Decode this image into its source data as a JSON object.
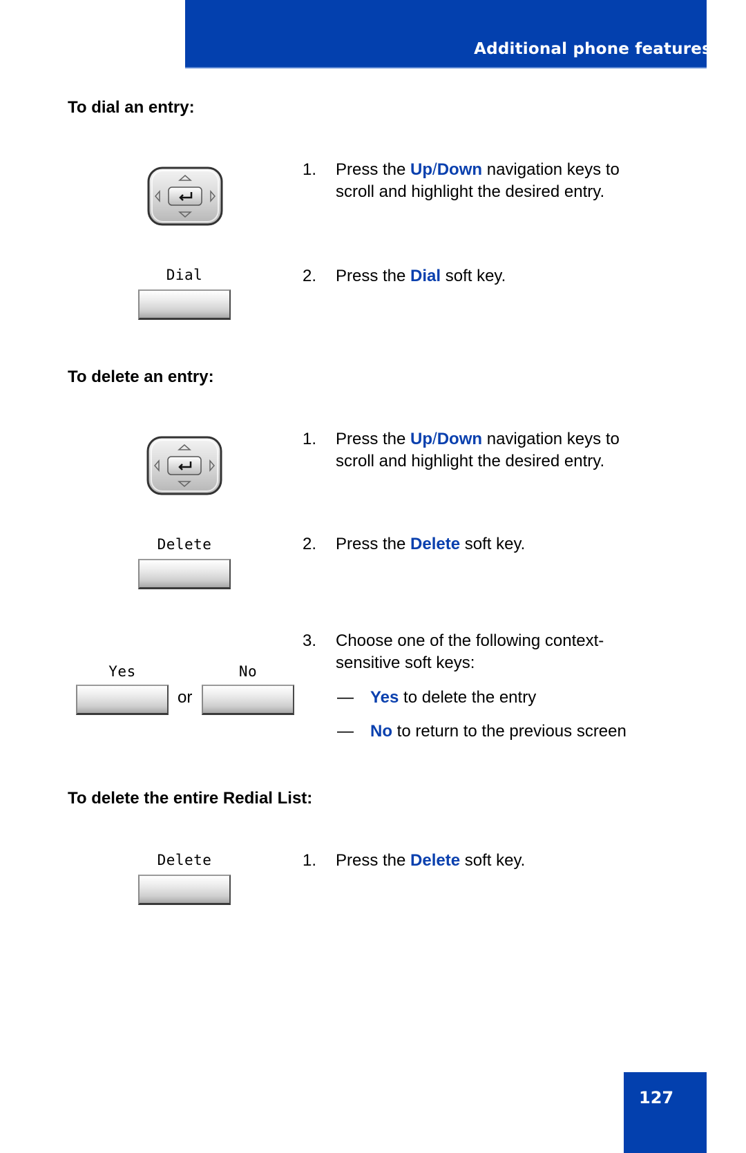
{
  "header": {
    "title": "Additional phone features"
  },
  "colors": {
    "brand_blue": "#0340ae",
    "highlight_blue": "#0a40ae"
  },
  "sections": [
    {
      "heading": "To dial an entry:",
      "steps": [
        {
          "num": "1.",
          "pre": "Press the ",
          "hl1": "Up",
          "sep": "/",
          "hl2": "Down",
          "post": " navigation keys to",
          "line2": "scroll and highlight the desired entry.",
          "icon": "navigation-pad-icon"
        },
        {
          "num": "2.",
          "pre": "Press the ",
          "hl": "Dial",
          "post": " soft key.",
          "softkey_label": "Dial"
        }
      ]
    },
    {
      "heading": "To delete an entry:",
      "steps": [
        {
          "num": "1.",
          "pre": "Press the ",
          "hl1": "Up",
          "sep": "/",
          "hl2": "Down",
          "post": " navigation keys to",
          "line2": "scroll and highlight the desired entry.",
          "icon": "navigation-pad-icon"
        },
        {
          "num": "2.",
          "pre": "Press the ",
          "hl": "Delete",
          "post": " soft key.",
          "softkey_label": "Delete"
        },
        {
          "num": "3.",
          "line1": "Choose one of the following context-",
          "line2": "sensitive soft keys:",
          "softkeys": [
            "Yes",
            "No"
          ],
          "or_label": "or",
          "options": [
            {
              "dash": "—",
              "hl": "Yes",
              "text": " to delete the entry"
            },
            {
              "dash": "—",
              "hl": "No",
              "text": " to return to the previous screen"
            }
          ]
        }
      ]
    },
    {
      "heading": "To delete the entire Redial List:",
      "steps": [
        {
          "num": "1.",
          "pre": "Press the ",
          "hl": "Delete",
          "post": " soft key.",
          "softkey_label": "Delete"
        }
      ]
    }
  ],
  "footer": {
    "page_number": "127"
  }
}
